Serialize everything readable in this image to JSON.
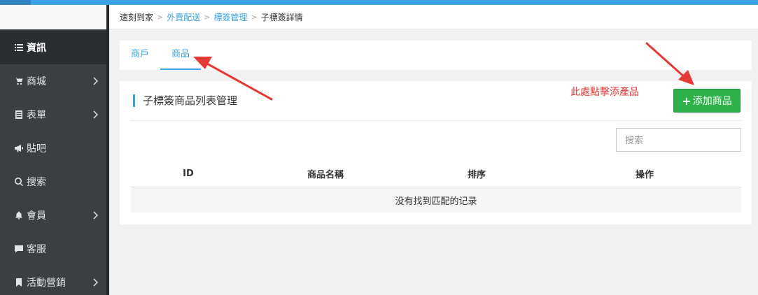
{
  "sidebar": {
    "items": [
      {
        "label": "資訊",
        "icon": "list-icon",
        "has_submenu": false,
        "active": true
      },
      {
        "label": "商城",
        "icon": "cart-icon",
        "has_submenu": true
      },
      {
        "label": "表單",
        "icon": "form-icon",
        "has_submenu": true
      },
      {
        "label": "貼吧",
        "icon": "megaphone-icon",
        "has_submenu": false
      },
      {
        "label": "搜索",
        "icon": "search-icon",
        "has_submenu": false
      },
      {
        "label": "會員",
        "icon": "bell-icon",
        "has_submenu": true
      },
      {
        "label": "客服",
        "icon": "chat-icon",
        "has_submenu": false
      },
      {
        "label": "活動營銷",
        "icon": "bookmark-icon",
        "has_submenu": true
      }
    ]
  },
  "breadcrumb": {
    "items": [
      "速刻到家",
      "外賣配送",
      "標簽管理",
      "子標簽詳情"
    ]
  },
  "tabs": [
    {
      "label": "商戶",
      "active": false
    },
    {
      "label": "商品",
      "active": true
    }
  ],
  "panel": {
    "title": "子標簽商品列表管理",
    "add_button_label": "添加商品",
    "search_placeholder": "搜索",
    "annotation": "此處點擊添產品"
  },
  "table": {
    "columns": [
      "ID",
      "商品名稱",
      "排序",
      "操作"
    ],
    "empty_text": "没有找到匹配的记录"
  },
  "colors": {
    "accent": "#3aa3e3",
    "add_button": "#2fb14b",
    "sidebar_bg": "#3a3f44",
    "annotation": "#e53935"
  }
}
